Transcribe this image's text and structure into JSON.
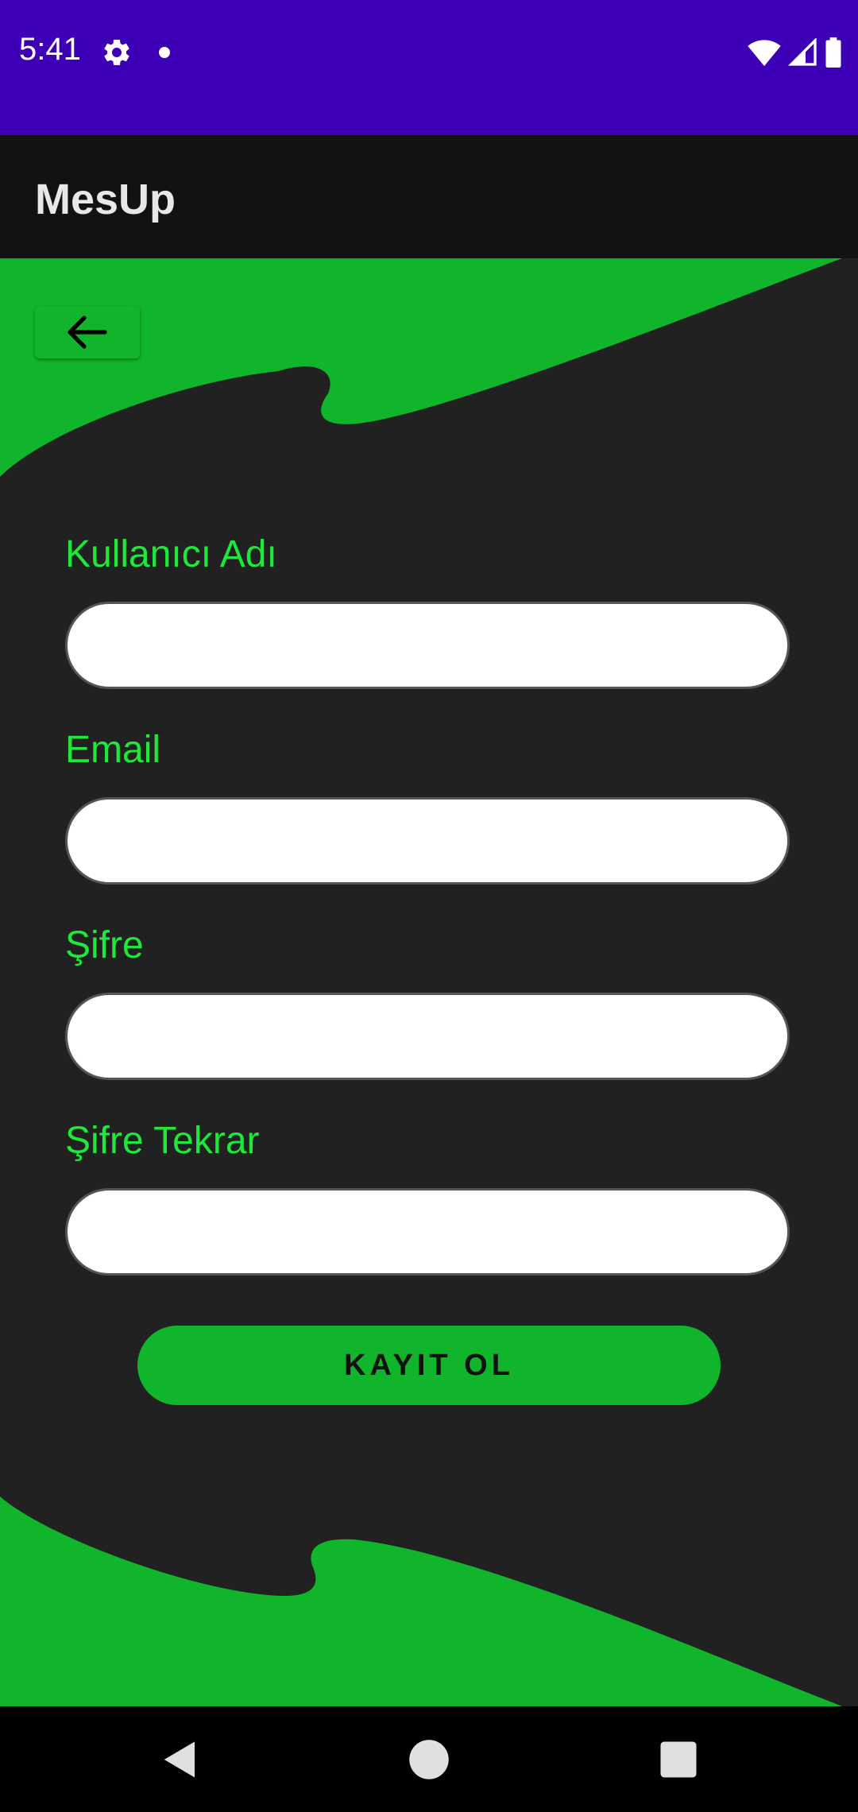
{
  "status_bar": {
    "time": "5:41",
    "icons": [
      "gear-icon",
      "notification-dot-icon",
      "wifi-icon",
      "cell-signal-icon",
      "battery-icon"
    ],
    "background": "#3d00b7"
  },
  "app_bar": {
    "title": "MesUp",
    "background": "#121212"
  },
  "form": {
    "back_icon": "arrow-left-icon",
    "fields": [
      {
        "label": "Kullanıcı Adı",
        "value": "",
        "placeholder": ""
      },
      {
        "label": "Email",
        "value": "",
        "placeholder": ""
      },
      {
        "label": "Şifre",
        "value": "",
        "placeholder": ""
      },
      {
        "label": "Şifre Tekrar",
        "value": "",
        "placeholder": ""
      }
    ],
    "submit_label": "KAYIT OL"
  },
  "colors": {
    "accent_green": "#10b52b",
    "label_green": "#1ee83a",
    "content_background": "#212121"
  },
  "nav_bar": {
    "icons": [
      "back-triangle-icon",
      "home-circle-icon",
      "recents-square-icon"
    ]
  }
}
